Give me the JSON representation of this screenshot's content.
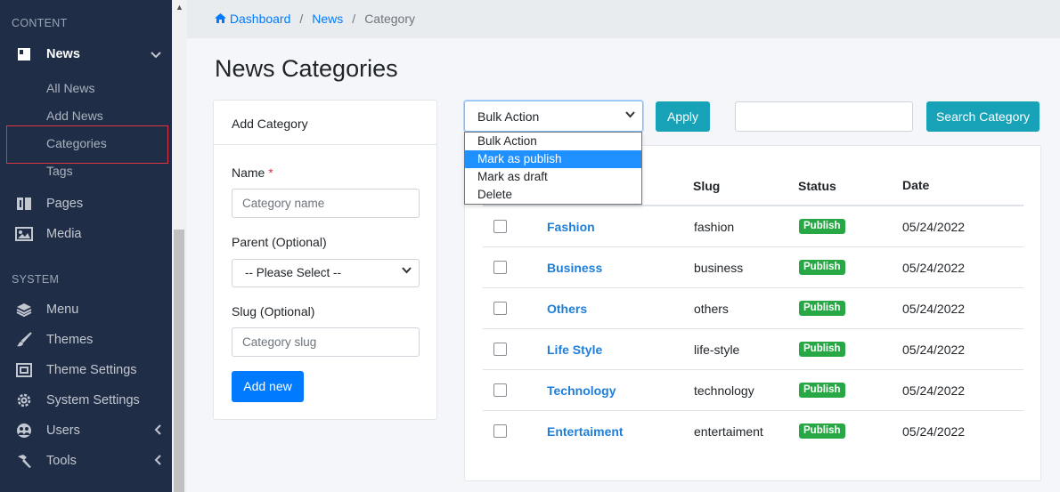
{
  "sidebar": {
    "content_header": "CONTENT",
    "system_header": "SYSTEM",
    "news": {
      "label": "News",
      "chevron": "chevron-down-icon"
    },
    "news_sub": [
      "All News",
      "Add News",
      "Categories",
      "Tags"
    ],
    "pages": "Pages",
    "media": "Media",
    "system_items": [
      "Menu",
      "Themes",
      "Theme Settings",
      "System Settings",
      "Users",
      "Tools"
    ]
  },
  "breadcrumb": {
    "home": "Dashboard",
    "news": "News",
    "current": "Category",
    "sep": "/"
  },
  "page_title": "News Categories",
  "add_form": {
    "title": "Add Category",
    "name_label": "Name",
    "required_mark": "*",
    "name_placeholder": "Category name",
    "parent_label": "Parent (Optional)",
    "parent_value": "-- Please Select --",
    "slug_label": "Slug (Optional)",
    "slug_placeholder": "Category slug",
    "submit": "Add new"
  },
  "toolbar": {
    "bulk_value": "Bulk Action",
    "bulk_options": [
      "Bulk Action",
      "Mark as publish",
      "Mark as draft",
      "Delete"
    ],
    "highlighted_option": "Mark as publish",
    "apply": "Apply",
    "search_value": "",
    "search_button": "Search Category"
  },
  "table": {
    "columns": {
      "slug": "Slug",
      "status": "Status",
      "date": "Date"
    },
    "rows": [
      {
        "name": "Fashion",
        "slug": "fashion",
        "status": "Publish",
        "date": "05/24/2022"
      },
      {
        "name": "Business",
        "slug": "business",
        "status": "Publish",
        "date": "05/24/2022"
      },
      {
        "name": "Others",
        "slug": "others",
        "status": "Publish",
        "date": "05/24/2022"
      },
      {
        "name": "Life Style",
        "slug": "life-style",
        "status": "Publish",
        "date": "05/24/2022"
      },
      {
        "name": "Technology",
        "slug": "technology",
        "status": "Publish",
        "date": "05/24/2022"
      },
      {
        "name": "Entertaiment",
        "slug": "entertaiment",
        "status": "Publish",
        "date": "05/24/2022"
      }
    ]
  },
  "colors": {
    "sidebar_bg": "#1f2d46",
    "primary": "#007bff",
    "info": "#17a2b8",
    "success": "#28a745",
    "danger": "#dc3545"
  }
}
